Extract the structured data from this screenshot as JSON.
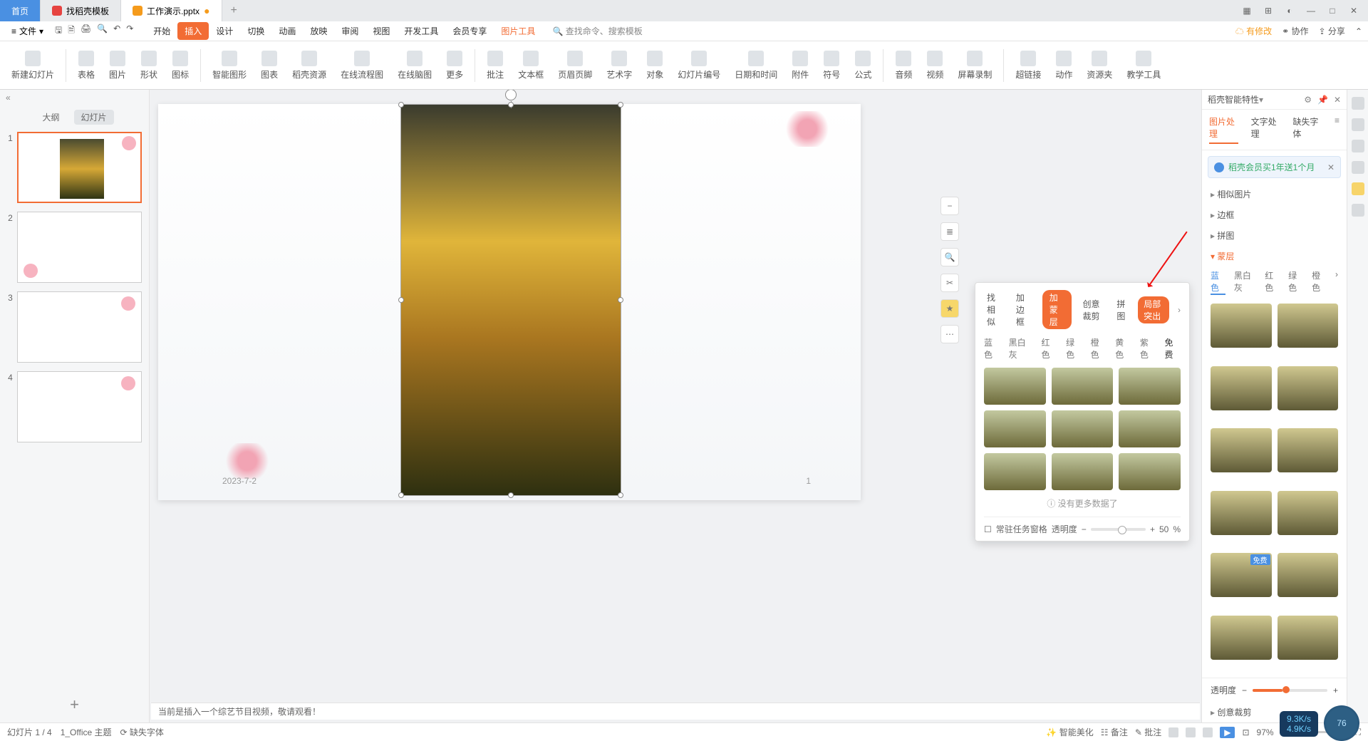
{
  "titlebar": {
    "home": "首页",
    "tab1": "找稻壳模板",
    "tab2": "工作演示.pptx",
    "modified": "●"
  },
  "menubar": {
    "file": "文件",
    "ribbontabs": [
      "开始",
      "插入",
      "设计",
      "切换",
      "动画",
      "放映",
      "审阅",
      "视图",
      "开发工具",
      "会员专享"
    ],
    "tooltab": "图片工具",
    "searchcmd": "查找命令、搜索模板",
    "right": {
      "unsaved": "有修改",
      "coop": "协作",
      "share": "分享"
    }
  },
  "ribbon": {
    "items": [
      "新建幻灯片",
      "表格",
      "图片",
      "形状",
      "图标",
      "智能图形",
      "图表",
      "稻壳资源",
      "在线流程图",
      "在线脑图",
      "更多",
      "批注",
      "文本框",
      "页眉页脚",
      "艺术字",
      "对象",
      "幻灯片编号",
      "日期和时间",
      "附件",
      "符号",
      "公式",
      "音频",
      "视频",
      "屏幕录制",
      "超链接",
      "动作",
      "资源夹",
      "教学工具"
    ]
  },
  "thumb": {
    "outline": "大纲",
    "slides": "幻灯片"
  },
  "slidebig": {
    "date": "2023-7-2",
    "page": "1"
  },
  "popup": {
    "tabs": [
      "找相似",
      "加边框",
      "加蒙层",
      "创意裁剪",
      "拼图",
      "局部突出"
    ],
    "colortabs": [
      "蓝色",
      "黑白灰",
      "红色",
      "绿色",
      "橙色",
      "黄色",
      "紫色",
      "免费"
    ],
    "nomore": "没有更多数据了",
    "pin": "常驻任务窗格",
    "opacity": "透明度",
    "opval": "50",
    "pct": "%"
  },
  "rpanel": {
    "title": "稻壳智能特性",
    "tabs": [
      "图片处理",
      "文字处理",
      "缺失字体"
    ],
    "banner": "稻壳会员买1年送1个月",
    "sections": [
      "相似图片",
      "边框",
      "拼图",
      "蒙层"
    ],
    "colors": [
      "蓝色",
      "黑白灰",
      "红色",
      "绿色",
      "橙色"
    ],
    "freebadge": "免费",
    "opacity": "透明度",
    "last": "创意裁剪"
  },
  "msgbar": "当前是插入一个综艺节目视频，敬请观看！",
  "status": {
    "slide": "幻灯片 1 / 4",
    "theme": "1_Office 主题",
    "missing": "缺失字体",
    "beautify": "智能美化",
    "notes": "备注",
    "comments": "批注",
    "zoom": "97%"
  },
  "perf": {
    "up": "9.3K/s",
    "down": "4.9K/s",
    "score": "76"
  }
}
